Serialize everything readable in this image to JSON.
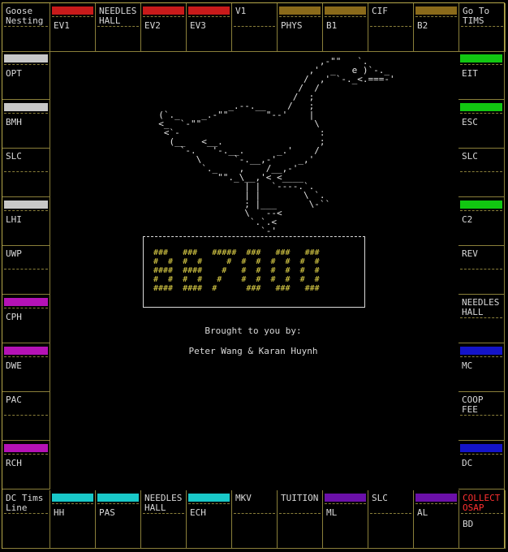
{
  "colors": {
    "red": "#c81a1a",
    "gold": "#8a6a1a",
    "gray": "#c8c8c8",
    "green": "#11c711",
    "magenta": "#b512b5",
    "blue": "#1414c8",
    "cyan": "#19c8c8",
    "purple": "#6b10a8"
  },
  "top_row": [
    {
      "label": "Goose\nNesting",
      "color": null
    },
    {
      "label": "EV1",
      "color": "red"
    },
    {
      "label": "NEEDLES\nHALL",
      "color": null
    },
    {
      "label": "EV2",
      "color": "red"
    },
    {
      "label": "EV3",
      "color": "red"
    },
    {
      "label": "V1",
      "color": null
    },
    {
      "label": "PHYS",
      "color": "gold"
    },
    {
      "label": "B1",
      "color": "gold"
    },
    {
      "label": "CIF",
      "color": null
    },
    {
      "label": "B2",
      "color": "gold"
    },
    {
      "label": "Go To\nTIMS",
      "color": null
    }
  ],
  "left_col": [
    {
      "label": "OPT",
      "color": "gray"
    },
    {
      "label": "BMH",
      "color": "gray"
    },
    {
      "label": "SLC",
      "color": null
    },
    {
      "label": "LHI",
      "color": "gray"
    },
    {
      "label": "UWP",
      "color": null
    },
    {
      "label": "CPH",
      "color": "magenta"
    },
    {
      "label": "DWE",
      "color": "magenta"
    },
    {
      "label": "PAC",
      "color": null
    },
    {
      "label": "RCH",
      "color": "magenta"
    }
  ],
  "right_col": [
    {
      "label": "EIT",
      "color": "green"
    },
    {
      "label": "ESC",
      "color": "green"
    },
    {
      "label": "SLC",
      "color": null
    },
    {
      "label": "C2",
      "color": "green"
    },
    {
      "label": "REV",
      "color": null
    },
    {
      "label": "NEEDLES\nHALL",
      "color": null
    },
    {
      "label": "MC",
      "color": "blue"
    },
    {
      "label": "COOP\nFEE",
      "color": null
    },
    {
      "label": "DC",
      "color": "blue"
    }
  ],
  "bottom_row": [
    {
      "label": "DC Tims\nLine",
      "color": null
    },
    {
      "label": "HH",
      "color": "cyan"
    },
    {
      "label": "PAS",
      "color": "cyan"
    },
    {
      "label": "NEEDLES\nHALL",
      "color": null
    },
    {
      "label": "ECH",
      "color": "cyan"
    },
    {
      "label": "MKV",
      "color": null
    },
    {
      "label": "TUITION",
      "color": null
    },
    {
      "label": "ML",
      "color": "purple"
    },
    {
      "label": "SLC",
      "color": null
    },
    {
      "label": "AL",
      "color": "purple"
    },
    {
      "label": "COLLECT\nOSAP",
      "color": null
    }
  ],
  "bottom_corner_extra": "BD",
  "goose_art": "                                ,-\"\"   `.\n                              ,'  _   e )`-._\n                             /  ,' `-._<.===-'\n                            /  /\n                           /  ;\n               _.--.__    /   ;\n  (`._    _.-\"\"       \"--'    |\n  <_  `-\"\"                     \\\n   <`-                          :\n    (__   <__.                  ;\n      `-.   '-.__.      _.'    /\n         \\      `-.__,-'    _,'\n          `._    ,    /__,-'\n             \"\"._\\__,'< <____\n                  | |  `----.`.\n                  | |        \\ `.\n                  ; |___      \\-``\n                  \\   --<\n                   `.`.<\n                     `-'",
  "logo_art": "###   ###   #####  ###   ###   ###\n#  #  #  #     #  #  #  #  #  #  #\n####  ####    #   #  #  #  #  #  #\n#  #  #  #   #    #  #  #  #  #  #\n####  ####  #      ###   ###   ###",
  "credits": {
    "line1": "Brought to you by:",
    "line2": "Peter Wang & Karan Huynh"
  }
}
